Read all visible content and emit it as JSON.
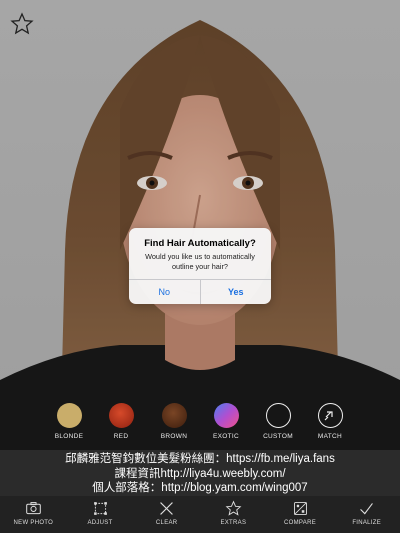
{
  "dialog": {
    "title": "Find Hair Automatically?",
    "message": "Would you like us to automatically outline your hair?",
    "no_label": "No",
    "yes_label": "Yes"
  },
  "swatches": [
    {
      "label": "BLONDE",
      "color": "#c9ad6a"
    },
    {
      "label": "RED",
      "color": "#b5321b"
    },
    {
      "label": "BROWN",
      "color": "#5a3019"
    },
    {
      "label": "EXOTIC",
      "color": "#8b5fd0"
    },
    {
      "label": "CUSTOM",
      "color": "transparent"
    },
    {
      "label": "MATCH",
      "color": "transparent"
    }
  ],
  "watermark": {
    "line1": "邱麟雅范智鈞數位美髮粉絲團：https://fb.me/liya.fans",
    "line2": "課程資訊http://liya4u.weebly.com/",
    "line3": "個人部落格：http://blog.yam.com/wing007"
  },
  "toolbar": [
    {
      "label": "NEW PHOTO",
      "icon": "camera-icon"
    },
    {
      "label": "ADJUST",
      "icon": "adjust-icon"
    },
    {
      "label": "CLEAR",
      "icon": "close-icon"
    },
    {
      "label": "EXTRAS",
      "icon": "star-icon"
    },
    {
      "label": "COMPARE",
      "icon": "compare-icon"
    },
    {
      "label": "FINALIZE",
      "icon": "checkmark-icon"
    }
  ]
}
